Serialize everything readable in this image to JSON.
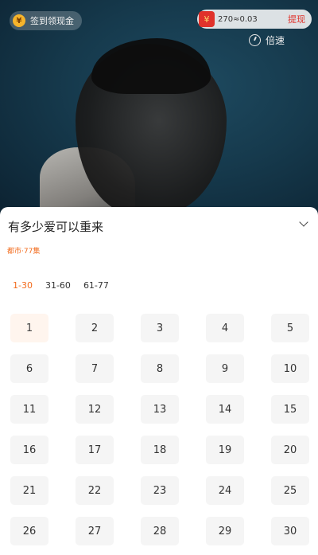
{
  "player": {
    "checkin_label": "签到领现金",
    "coin_icon": "coin-icon",
    "reward_amount": "270≈0.03",
    "withdraw_label": "提现",
    "speed_label": "倍速"
  },
  "drama": {
    "title": "有多少爱可以重来",
    "meta": "都市·77集"
  },
  "episode_ranges": [
    "1-30",
    "31-60",
    "61-77"
  ],
  "active_range": "1-30",
  "episodes": [
    "1",
    "2",
    "3",
    "4",
    "5",
    "6",
    "7",
    "8",
    "9",
    "10",
    "11",
    "12",
    "13",
    "14",
    "15",
    "16",
    "17",
    "18",
    "19",
    "20",
    "21",
    "22",
    "23",
    "24",
    "25",
    "26",
    "27",
    "28",
    "29",
    "30"
  ],
  "active_episode": "1",
  "colors": {
    "accent": "#f26b1d",
    "sheet_bg": "#ffffff",
    "tile_bg": "#f5f5f5",
    "active_tile_bg": "#fff5ee"
  }
}
